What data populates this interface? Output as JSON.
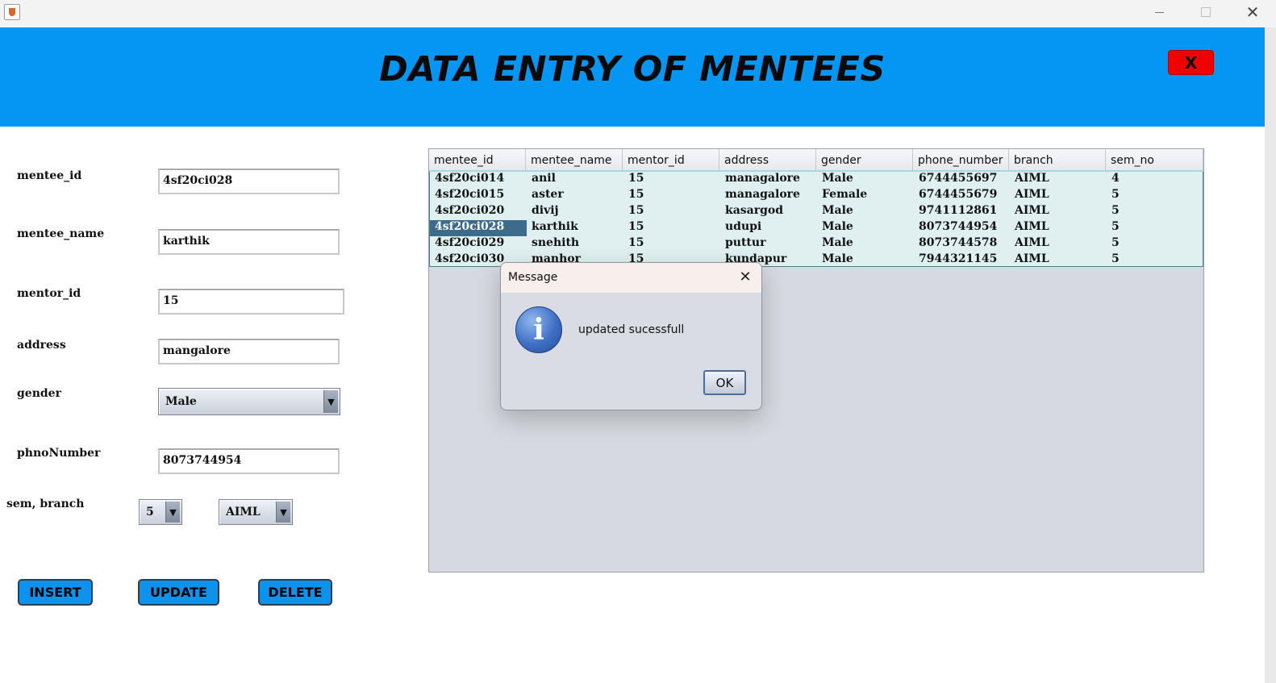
{
  "window": {
    "minimize_icon": "minimize-icon",
    "maximize_icon": "maximize-icon",
    "close_glyph": "✕"
  },
  "header": {
    "title": "DATA ENTRY  OF MENTEES",
    "close_label": "X",
    "bg_color": "#0595f2",
    "close_color": "#f00000"
  },
  "form": {
    "mentee_id": {
      "label": "mentee_id",
      "value": "4sf20ci028"
    },
    "mentee_name": {
      "label": "mentee_name",
      "value": "karthik"
    },
    "mentor_id": {
      "label": "mentor_id",
      "value": "15"
    },
    "address": {
      "label": "address",
      "value": "mangalore"
    },
    "gender": {
      "label": "gender",
      "value": "Male"
    },
    "phone": {
      "label": "phnoNumber",
      "value": "8073744954"
    },
    "sem_branch": {
      "label": "sem, branch",
      "sem": "5",
      "branch": "AIML"
    }
  },
  "buttons": {
    "insert": "INSERT",
    "update": "UPDATE",
    "delete": "DELETE",
    "color": "#0d93ec"
  },
  "table": {
    "columns": [
      "mentee_id",
      "mentee_name",
      "mentor_id",
      "address",
      "gender",
      "phone_number",
      "branch",
      "sem_no"
    ],
    "rows": [
      [
        "4sf20ci014",
        "anil",
        "15",
        "managalore",
        "Male",
        "6744455697",
        "AIML",
        "4"
      ],
      [
        "4sf20ci015",
        "aster",
        "15",
        "managalore",
        "Female",
        "6744455679",
        "AIML",
        "5"
      ],
      [
        "4sf20ci020",
        "divij",
        "15",
        "kasargod",
        "Male",
        "9741112861",
        "AIML",
        "5"
      ],
      [
        "4sf20ci028",
        "karthik",
        "15",
        "udupi",
        "Male",
        "8073744954",
        "AIML",
        "5"
      ],
      [
        "4sf20ci029",
        "snehith",
        "15",
        "puttur",
        "Male",
        "8073744578",
        "AIML",
        "5"
      ],
      [
        "4sf20ci030",
        "manhor",
        "15",
        "kundapur",
        "Male",
        "7944321145",
        "AIML",
        "5"
      ]
    ],
    "selected_row": 3
  },
  "dialog": {
    "title": "Message",
    "close_glyph": "✕",
    "message": "updated sucessfull",
    "ok_label": "OK",
    "icon": "information-icon",
    "icon_glyph": "i"
  }
}
